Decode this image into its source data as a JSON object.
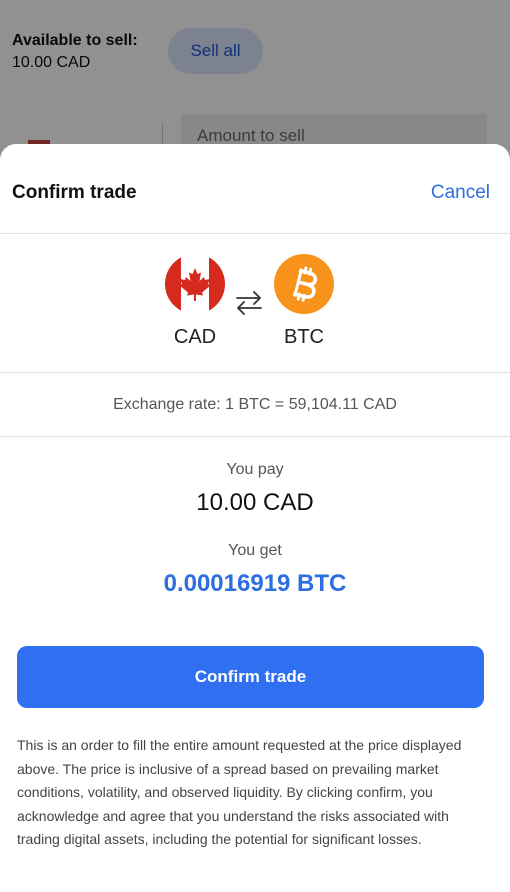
{
  "background": {
    "available_label": "Available to sell:",
    "available_value": "10.00 CAD",
    "sell_all_label": "Sell all",
    "amount_placeholder": "Amount to sell"
  },
  "sheet": {
    "title": "Confirm trade",
    "cancel_label": "Cancel",
    "pair": {
      "from": "CAD",
      "to": "BTC",
      "from_icon": "canada-flag-icon",
      "to_icon": "bitcoin-icon",
      "swap_icon": "swap-arrows-icon"
    },
    "exchange_rate": "Exchange rate: 1 BTC = 59,104.11 CAD",
    "you_pay_label": "You pay",
    "you_pay_value": "10.00 CAD",
    "you_get_label": "You get",
    "you_get_value": "0.00016919 BTC",
    "confirm_label": "Confirm trade",
    "disclaimer": "This is an order to fill the entire amount requested at the price displayed above. The price is inclusive of a spread based on prevailing market conditions, volatility, and observed liquidity. By clicking confirm, you acknowledge and agree that you understand the risks associated with trading digital assets, including the potential for significant losses."
  },
  "colors": {
    "accent": "#2f6ff0",
    "link": "#2d6ee0",
    "bitcoin": "#f7931a",
    "canada_red": "#d52b1e"
  }
}
